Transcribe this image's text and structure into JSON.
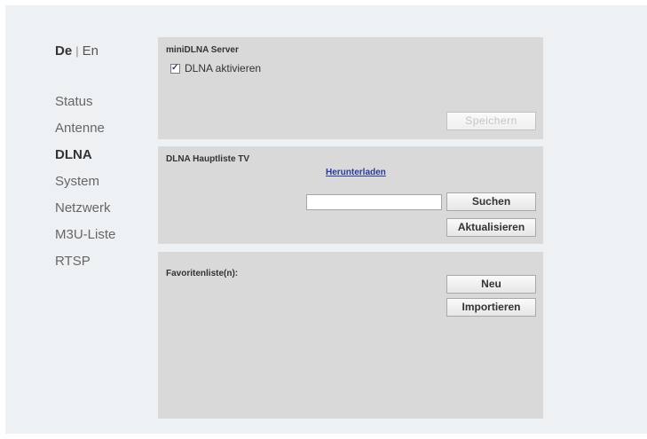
{
  "lang": {
    "active": "De",
    "separator": "|",
    "other": "En"
  },
  "nav": {
    "items": [
      {
        "label": "Status"
      },
      {
        "label": "Antenne"
      },
      {
        "label": "DLNA"
      },
      {
        "label": "System"
      },
      {
        "label": "Netzwerk"
      },
      {
        "label": "M3U-Liste"
      },
      {
        "label": "RTSP"
      }
    ],
    "active": "DLNA"
  },
  "server_panel": {
    "title": "miniDLNA Server",
    "checkbox_label": "DLNA aktivieren",
    "checkbox_checked": true,
    "save_label": "Speichern"
  },
  "list_panel": {
    "title": "DLNA Hauptliste TV",
    "download_link": "Herunterladen",
    "search_value": "",
    "search_label": "Suchen",
    "refresh_label": "Aktualisieren"
  },
  "fav_panel": {
    "title": "Favoritenliste(n):",
    "new_label": "Neu",
    "import_label": "Importieren"
  }
}
